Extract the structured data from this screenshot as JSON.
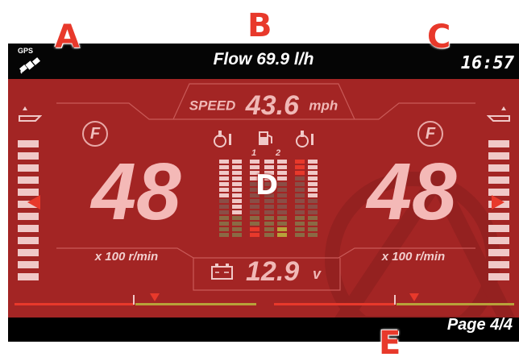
{
  "callouts": {
    "a": "A",
    "b": "B",
    "c": "C",
    "d": "D",
    "e": "E"
  },
  "topbar": {
    "gps_label": "GPS",
    "flow_text": "Flow 69.9 l/h",
    "clock": "16:57"
  },
  "speed": {
    "label": "SPEED",
    "value": "43.6",
    "unit": "mph"
  },
  "engines": {
    "left": {
      "fuel_badge": "F",
      "rpm": "48",
      "unit": "x 100 r/min"
    },
    "right": {
      "fuel_badge": "F",
      "rpm": "48",
      "unit": "x 100 r/min"
    }
  },
  "center_gauges": {
    "left_bar_label": "1",
    "right_bar_label": "2"
  },
  "voltage": {
    "value": "12.9",
    "unit": "v"
  },
  "footer": {
    "page_label": "Page 4/4"
  },
  "colors": {
    "display_bg": "#a32524",
    "accent_red": "#e8392b",
    "bar_yellow": "#b8a23a",
    "bar_light": "#f0c8c7"
  }
}
